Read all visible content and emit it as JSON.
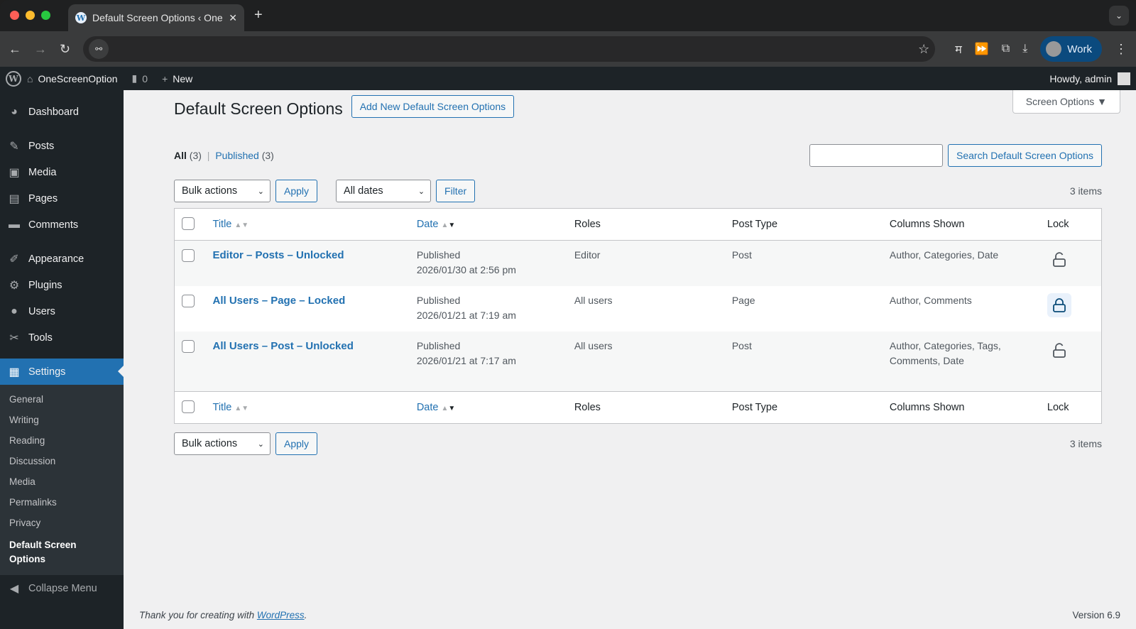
{
  "browser": {
    "tab_title": "Default Screen Options ‹ OneScreenOption",
    "profile": "Work",
    "ext_label": "म"
  },
  "adminbar": {
    "site": "OneScreenOption",
    "comments": "0",
    "new": "New",
    "howdy": "Howdy, admin"
  },
  "sidebar": {
    "items": [
      {
        "label": "Dashboard",
        "icon": "◕"
      },
      {
        "label": "Posts",
        "icon": "✎"
      },
      {
        "label": "Media",
        "icon": "▣"
      },
      {
        "label": "Pages",
        "icon": "▤"
      },
      {
        "label": "Comments",
        "icon": "▬"
      },
      {
        "label": "Appearance",
        "icon": "✐"
      },
      {
        "label": "Plugins",
        "icon": "⚙"
      },
      {
        "label": "Users",
        "icon": "●"
      },
      {
        "label": "Tools",
        "icon": "✂"
      },
      {
        "label": "Settings",
        "icon": "▦"
      }
    ],
    "submenu": [
      "General",
      "Writing",
      "Reading",
      "Discussion",
      "Media",
      "Permalinks",
      "Privacy",
      "Default Screen Options"
    ],
    "collapse": "Collapse Menu"
  },
  "page": {
    "screen_options": "Screen Options ▼",
    "title": "Default Screen Options",
    "add_new": "Add New Default Screen Options",
    "filters": {
      "all": "All",
      "all_count": "(3)",
      "sep": "|",
      "published": "Published",
      "published_count": "(3)"
    },
    "search_placeholder": "",
    "search_button": "Search Default Screen Options",
    "bulk": "Bulk actions",
    "apply": "Apply",
    "dates": "All dates",
    "filter": "Filter",
    "items": "3 items",
    "columns": [
      "Title",
      "Date",
      "Roles",
      "Post Type",
      "Columns Shown",
      "Lock"
    ],
    "rows": [
      {
        "title": "Editor – Posts – Unlocked",
        "status": "Published",
        "date": "2026/01/30 at 2:56 pm",
        "roles": "Editor",
        "type": "Post",
        "cols": "Author, Categories, Date",
        "locked": false
      },
      {
        "title": "All Users – Page – Locked",
        "status": "Published",
        "date": "2026/01/21 at 7:19 am",
        "roles": "All users",
        "type": "Page",
        "cols": "Author, Comments",
        "locked": true
      },
      {
        "title": "All Users – Post – Unlocked",
        "status": "Published",
        "date": "2026/01/21 at 7:17 am",
        "roles": "All users",
        "type": "Post",
        "cols": "Author, Categories, Tags, Comments, Date",
        "locked": false
      }
    ]
  },
  "footer": {
    "thanks": "Thank you for creating with ",
    "wp": "WordPress",
    "dot": ".",
    "version": "Version 6.9"
  }
}
